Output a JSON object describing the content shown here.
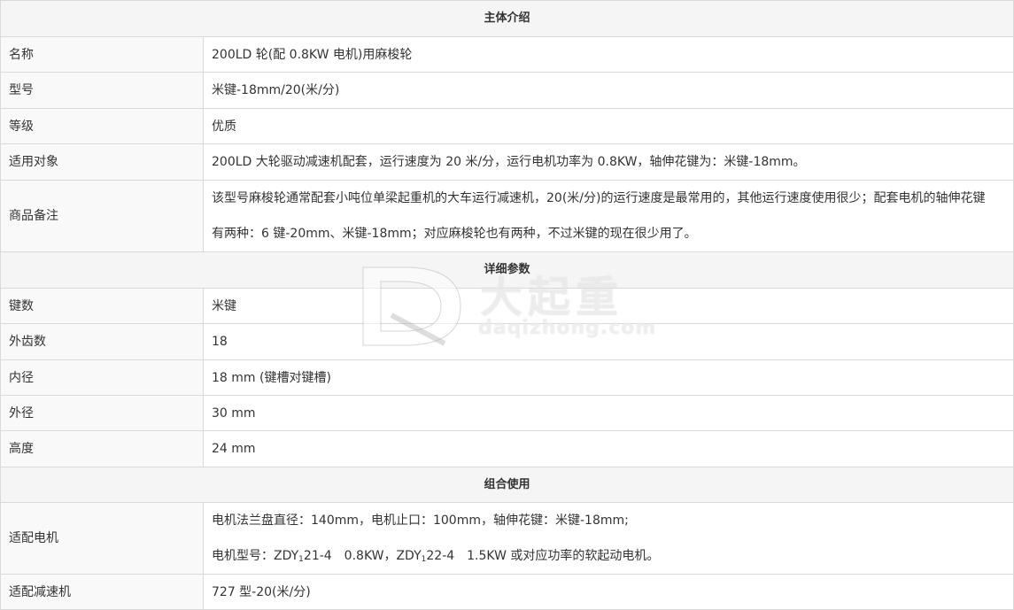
{
  "sections": {
    "intro": "主体介绍",
    "detail": "详细参数",
    "combo": "组合使用"
  },
  "intro_rows": [
    {
      "label": "名称",
      "value": "200LD 轮(配 0.8KW 电机)用麻梭轮"
    },
    {
      "label": "型号",
      "value": "米键-18mm/20(米/分)"
    },
    {
      "label": "等级",
      "value": "优质"
    },
    {
      "label": "适用对象",
      "value": "200LD 大轮驱动减速机配套，运行速度为 20 米/分，运行电机功率为 0.8KW，轴伸花键为：米键-18mm。"
    },
    {
      "label": "商品备注",
      "value_line1": "该型号麻梭轮通常配套小吨位单梁起重机的大车运行减速机，20(米/分)的运行速度是最常用的，其他运行速度使用很少；配套电机的轴伸花键",
      "value_line2": "有两种：6 键-20mm、米键-18mm；对应麻梭轮也有两种，不过米键的现在很少用了。"
    }
  ],
  "detail_rows": [
    {
      "label": "键数",
      "value": "米键"
    },
    {
      "label": "外齿数",
      "value": "18"
    },
    {
      "label": "内径",
      "value": "18 mm (键槽对键槽)"
    },
    {
      "label": "外径",
      "value": "30 mm"
    },
    {
      "label": "高度",
      "value": "24 mm"
    }
  ],
  "combo_rows": {
    "motor": {
      "label": "适配电机",
      "line1": "电机法兰盘直径：140mm，电机止口：100mm，轴伸花键：米键-18mm;",
      "line2_prefix": "电机型号：ZDY",
      "line2_sub1": "1",
      "line2_mid": "21-4　0.8KW，ZDY",
      "line2_sub2": "1",
      "line2_suffix": "22-4　1.5KW 或对应功率的软起动电机。"
    },
    "reducer": {
      "label": "适配减速机",
      "value": "727 型-20(米/分)"
    }
  },
  "watermark": {
    "cn": "大起重",
    "en": "daqizhong.com"
  }
}
